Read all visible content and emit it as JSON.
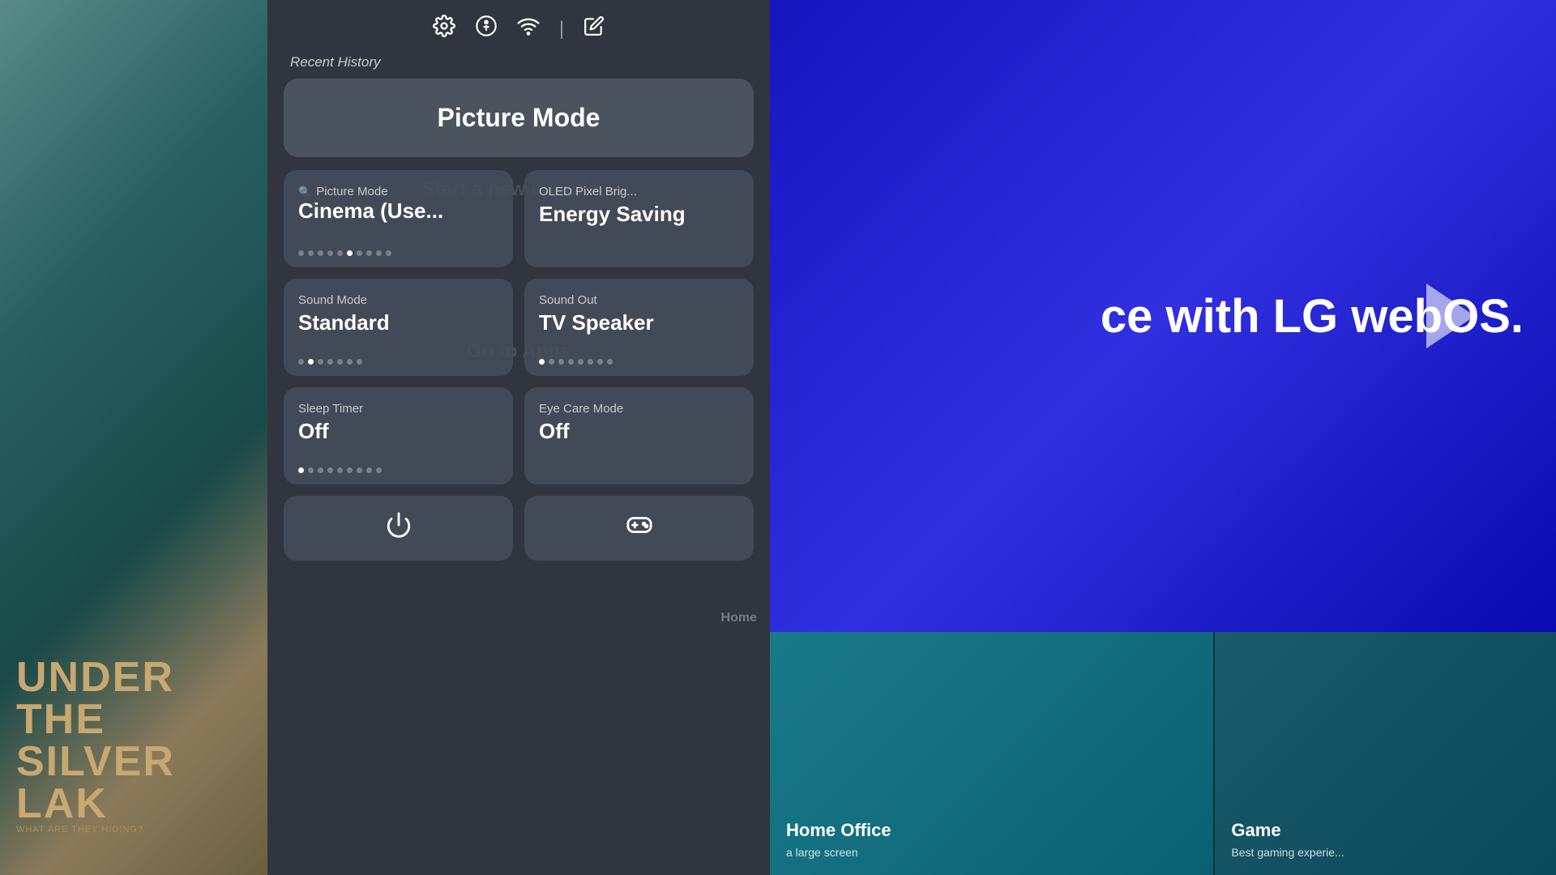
{
  "background": {
    "left_movie_title": "UNDER THE SILVER LAK",
    "left_movie_subtitle": "WHAT ARE THEY HIDING?",
    "right_title": "ce with LG webOS.",
    "right_play_visible": true
  },
  "top_icons": {
    "settings": "⚙",
    "accessibility": "Ⓐ",
    "wifi": "WiFi",
    "divider": "|",
    "edit": "✏"
  },
  "recent_history_label": "Recent History",
  "picture_mode_button": {
    "label": "Picture Mode"
  },
  "cards": [
    {
      "id": "picture-mode-card",
      "label": "Picture Mode",
      "value": "Cinema (Use...",
      "has_icon": true,
      "dots": [
        0,
        0,
        0,
        0,
        0,
        1,
        0,
        0,
        0,
        0
      ],
      "active_dot": 5
    },
    {
      "id": "oled-pixel-card",
      "label": "OLED Pixel Brig...",
      "value": "Energy Saving",
      "has_icon": false,
      "dots": [],
      "active_dot": -1
    },
    {
      "id": "sound-mode-card",
      "label": "Sound Mode",
      "value": "Standard",
      "has_icon": false,
      "dots": [
        0,
        1,
        0,
        0,
        0,
        0,
        0
      ],
      "active_dot": 1
    },
    {
      "id": "sound-out-card",
      "label": "Sound Out",
      "value": "TV Speaker",
      "has_icon": false,
      "dots": [
        1,
        0,
        0,
        0,
        0,
        0,
        0,
        0
      ],
      "active_dot": 0
    },
    {
      "id": "sleep-timer-card",
      "label": "Sleep Timer",
      "value": "Off",
      "has_icon": false,
      "dots": [
        1,
        0,
        0,
        0,
        0,
        0,
        0,
        0,
        0
      ],
      "active_dot": 0
    },
    {
      "id": "eye-care-mode-card",
      "label": "Eye Care Mode",
      "value": "Off",
      "has_icon": false,
      "dots": [],
      "active_dot": -1
    }
  ],
  "bottom_cards": [
    {
      "id": "power-card",
      "icon": "⏻"
    },
    {
      "id": "game-card",
      "icon": "🎮"
    }
  ],
  "right_bottom": [
    {
      "title": "Home Office",
      "subtitle": "a large screen"
    },
    {
      "title": "Game",
      "subtitle": "Best gaming experie..."
    }
  ],
  "overlay_texts": {
    "start_new": "Start a new experie...",
    "go_to_apps": "Go to Apps"
  }
}
